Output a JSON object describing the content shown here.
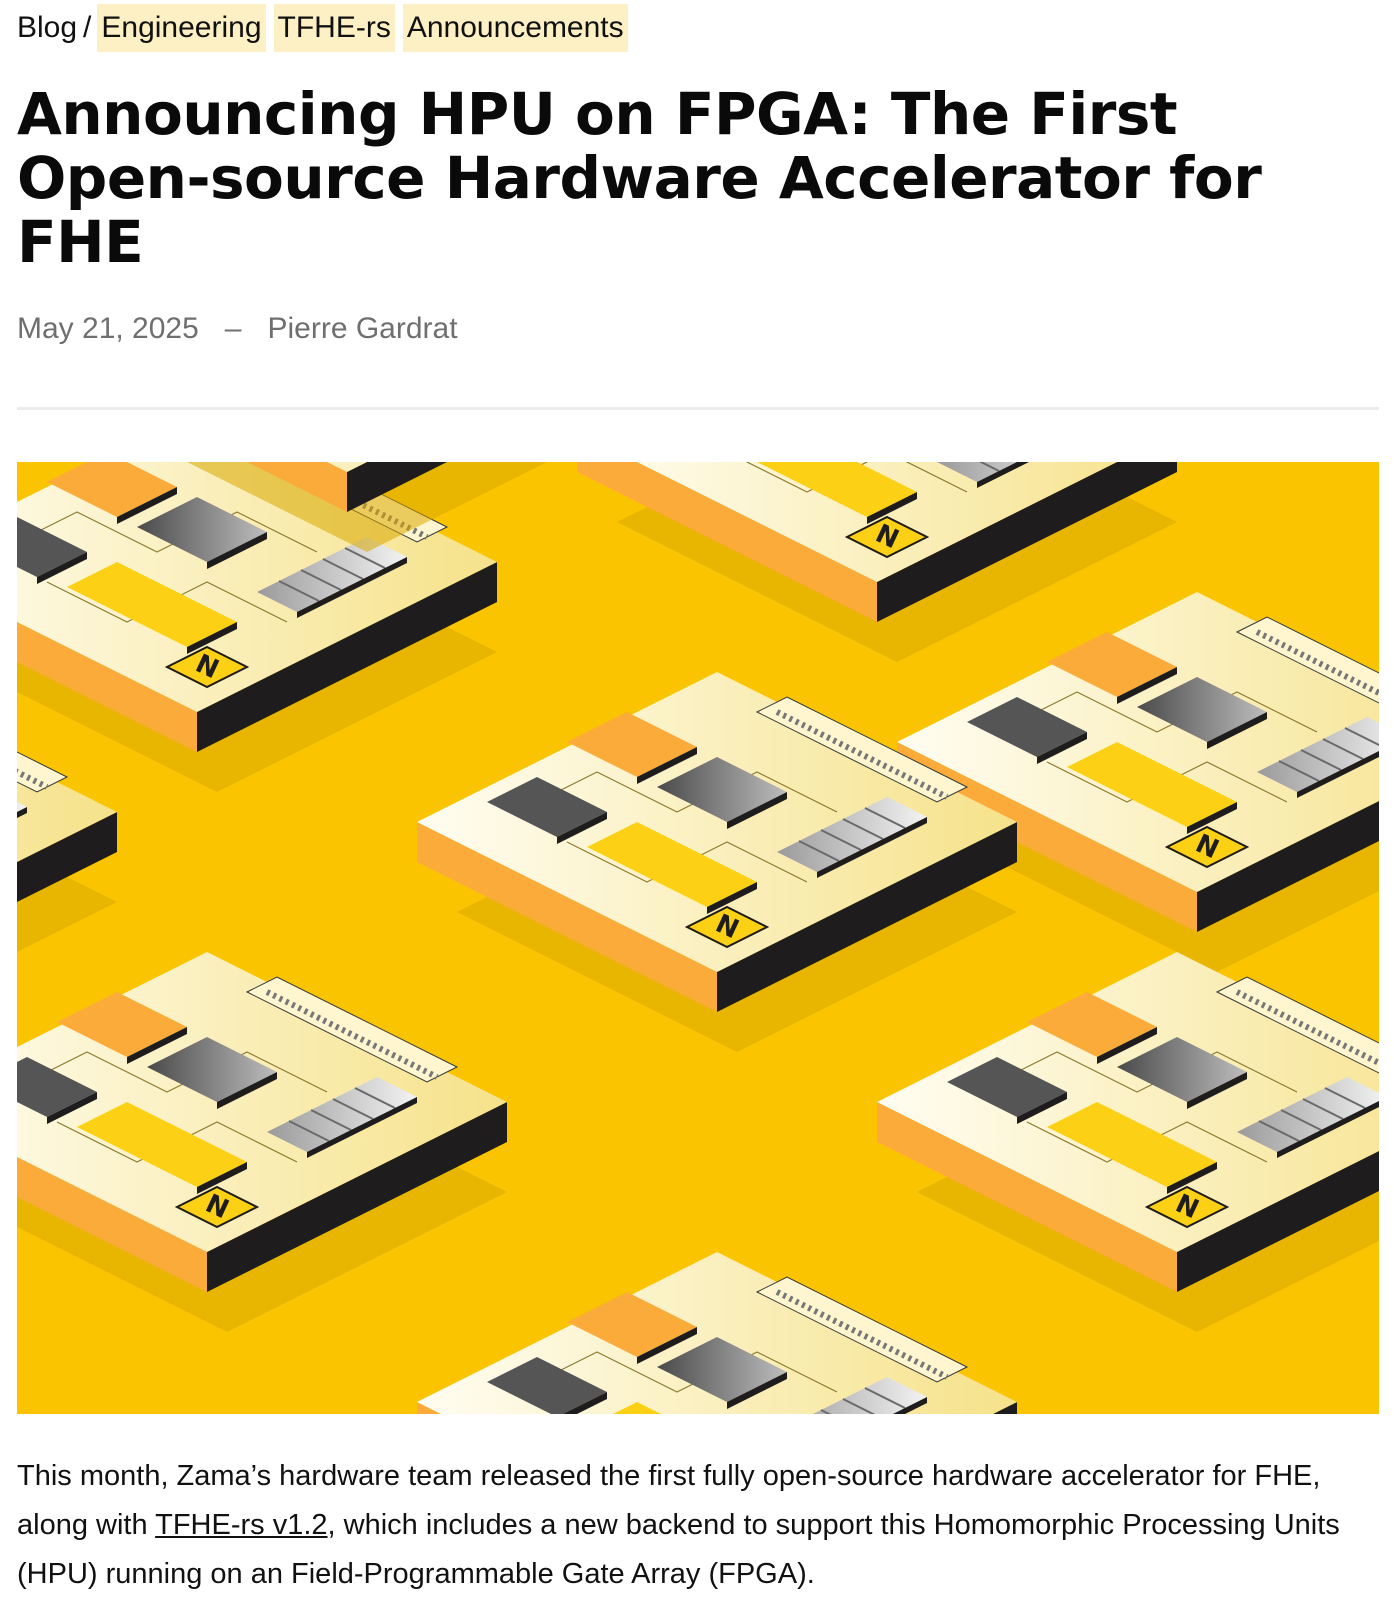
{
  "breadcrumb": {
    "root": "Blog",
    "separator": "/",
    "tags": [
      "Engineering",
      "TFHE-rs",
      "Announcements"
    ]
  },
  "article": {
    "title": "Announcing HPU on FPGA: The First Open-source Hardware Accelerator for FHE",
    "date": "May 21, 2025",
    "separator": "–",
    "author": "Pierre Gardrat"
  },
  "hero": {
    "icon": "isometric-chip-pattern",
    "chip_badge": "N",
    "colors": {
      "background": "#fac500",
      "board_light": "#fffbe8",
      "board_side": "#1e1c1c",
      "orange_block": "#fbab3a",
      "yellow_block": "#fcd115",
      "grey_block": "#6f6f6f"
    }
  },
  "body": {
    "intro_before": "This month, Zama’s hardware team released the first fully open-source hardware accelerator for FHE, along with ",
    "link": "TFHE-rs v1.2",
    "intro_after": ", which includes a new backend to support this Homomorphic Processing Units (HPU) running on an Field-Programmable Gate Array (FPGA)."
  }
}
